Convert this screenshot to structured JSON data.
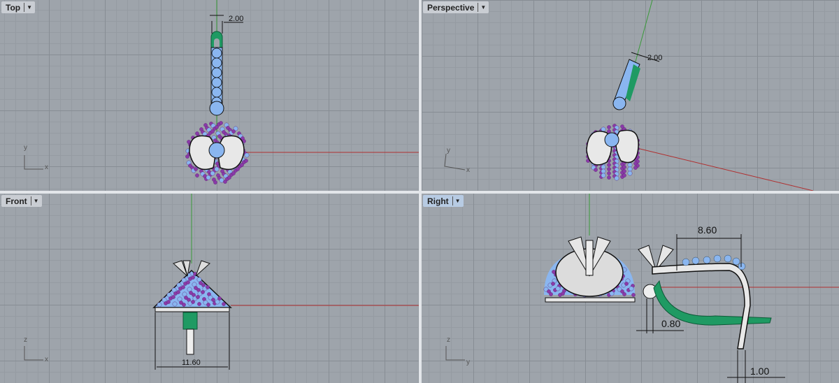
{
  "viewports": {
    "top": {
      "label": "Top",
      "dimension": "2.00",
      "axis_x": "x",
      "axis_y": "y"
    },
    "perspective": {
      "label": "Perspective",
      "dimension": "2.00",
      "axis_x": "x",
      "axis_y": "y"
    },
    "front": {
      "label": "Front",
      "dimension": "11.60",
      "axis_x": "x",
      "axis_y": "z"
    },
    "right": {
      "label": "Right",
      "dimension_top": "8.60",
      "dimension_mid": "0.80",
      "dimension_bottom": "1.00",
      "axis_x": "y",
      "axis_y": "z",
      "active": true
    }
  },
  "icons": {
    "dropdown": "chevron-down-icon"
  },
  "colors": {
    "viewport_bg": "#9ea4ab",
    "x_axis": "#b03030",
    "y_axis": "#3a9a3a",
    "gem": "#8ab6f0",
    "pave": "#8a3aa8",
    "metal_green": "#1f9a63"
  }
}
